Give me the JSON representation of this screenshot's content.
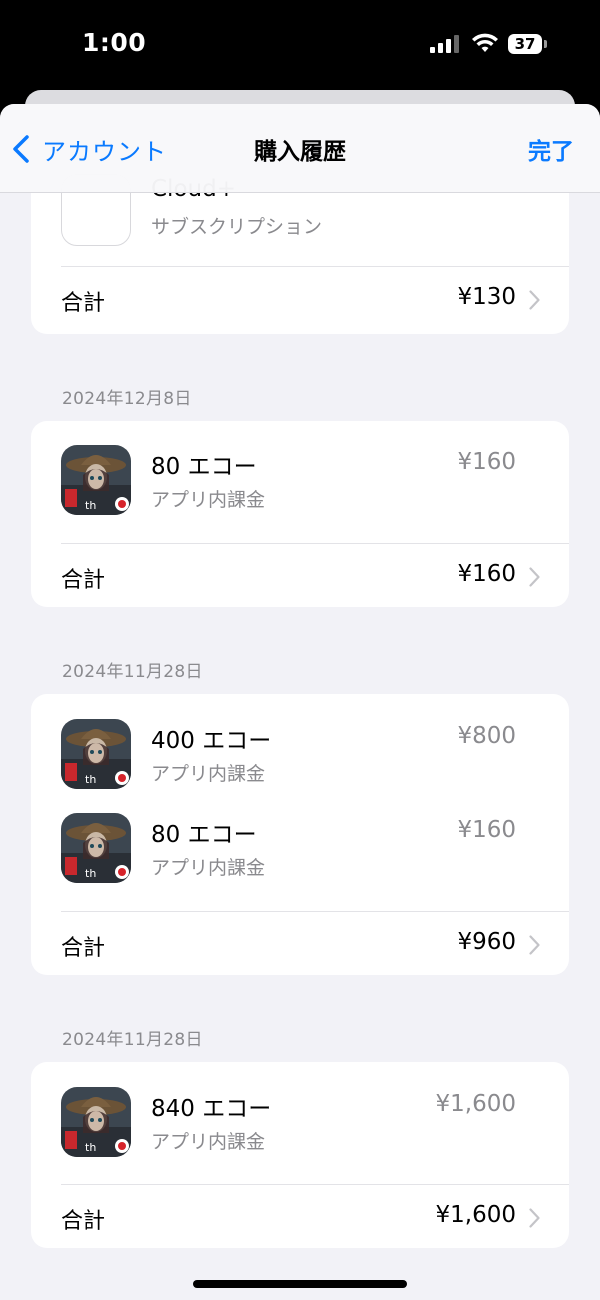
{
  "status_bar": {
    "time": "1:00",
    "battery": "37"
  },
  "nav": {
    "back_label": "アカウント",
    "title": "購入履歴",
    "done_label": "完了"
  },
  "top_card": {
    "item_name": "Cloud+",
    "item_type": "サブスクリプション",
    "total_label": "合計",
    "total_price": "¥130"
  },
  "sections": [
    {
      "date": "2024年12月8日",
      "items": [
        {
          "name": "80 エコー",
          "type": "アプリ内課金",
          "price": "¥160"
        }
      ],
      "total_label": "合計",
      "total_price": "¥160"
    },
    {
      "date": "2024年11月28日",
      "items": [
        {
          "name": "400 エコー",
          "type": "アプリ内課金",
          "price": "¥800"
        },
        {
          "name": "80 エコー",
          "type": "アプリ内課金",
          "price": "¥160"
        }
      ],
      "total_label": "合計",
      "total_price": "¥960"
    },
    {
      "date": "2024年11月28日",
      "items": [
        {
          "name": "840 エコー",
          "type": "アプリ内課金",
          "price": "¥1,600"
        }
      ],
      "total_label": "合計",
      "total_price": "¥1,600"
    }
  ],
  "colors": {
    "accent": "#0a7aff",
    "background": "#f2f2f7",
    "secondary_text": "#8a8a8e"
  },
  "icons": [
    "chevron-left-icon",
    "chevron-right-icon",
    "wifi-icon",
    "signal-icon",
    "battery-icon",
    "app-icon"
  ]
}
